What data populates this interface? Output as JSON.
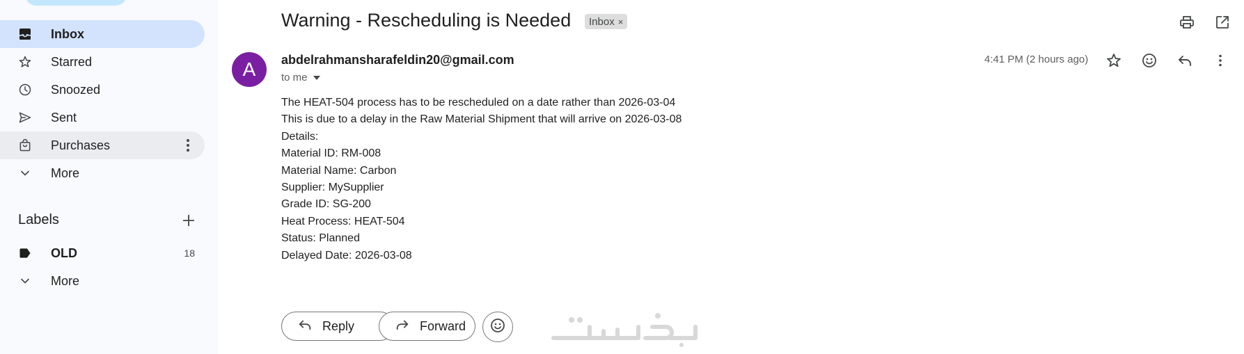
{
  "sidebar": {
    "items": [
      {
        "label": "Inbox",
        "icon": "inbox-icon"
      },
      {
        "label": "Starred",
        "icon": "star-icon"
      },
      {
        "label": "Snoozed",
        "icon": "clock-icon"
      },
      {
        "label": "Sent",
        "icon": "send-icon"
      },
      {
        "label": "Purchases",
        "icon": "shopping-bag-icon"
      },
      {
        "label": "More",
        "icon": "chevron-down-icon"
      }
    ],
    "labels_title": "Labels",
    "labels": [
      {
        "label": "OLD",
        "count": "18",
        "icon": "label-icon"
      },
      {
        "label": "More",
        "icon": "chevron-down-icon"
      }
    ]
  },
  "email": {
    "subject": "Warning - Rescheduling is Needed",
    "chip_label": "Inbox",
    "chip_close": "×",
    "avatar_letter": "A",
    "avatar_color": "#7b1fa2",
    "sender": "abdelrahmansharafeldin20@gmail.com",
    "recipient": "to me",
    "timestamp": "4:41 PM (2 hours ago)",
    "body": [
      "The HEAT-504 process has to be rescheduled on a date rather than 2026-03-04",
      "This is due to a delay in the Raw Material Shipment that will arrive on 2026-03-08",
      "Details:",
      "Material ID: RM-008",
      "Material Name: Carbon",
      "Supplier: MySupplier",
      "Grade ID: SG-200",
      "Heat Process: HEAT-504",
      "Status: Planned",
      "Delayed Date: 2026-03-08"
    ]
  },
  "actions": {
    "reply_label": "Reply",
    "forward_label": "Forward"
  },
  "colors": {
    "active_nav": "#d3e3fd",
    "sidebar_bg": "#f8fafd"
  }
}
